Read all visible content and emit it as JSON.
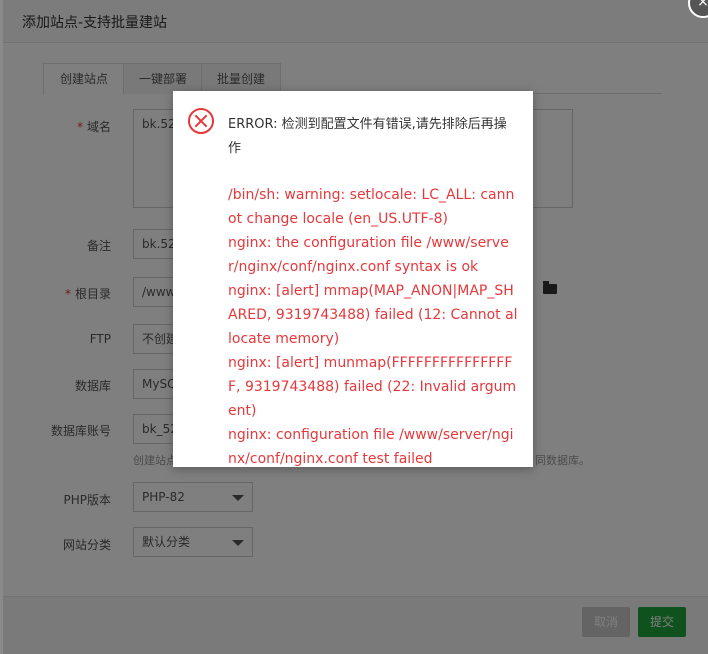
{
  "dialog": {
    "title": "添加站点-支持批量建站",
    "tabs": [
      "创建站点",
      "一键部署",
      "批量创建"
    ]
  },
  "form": {
    "domain_label": "域名",
    "domain_value": "bk.52",
    "remark_label": "备注",
    "remark_value": "bk.52",
    "root_label": "根目录",
    "root_value": "/www",
    "ftp_label": "FTP",
    "ftp_value": "不创建",
    "db_label": "数据库",
    "db_value": "MySQ",
    "db_account_label": "数据库账号",
    "db_account_value": "bk_52",
    "db_hint_left": "创建站点",
    "db_hint_right": "同数据库。",
    "php_label": "PHP版本",
    "php_value": "PHP-82",
    "category_label": "网站分类",
    "category_value": "默认分类"
  },
  "footer": {
    "cancel_label": "取消",
    "submit_label": "提交"
  },
  "error": {
    "title": "ERROR: 检测到配置文件有错误,请先排除后再操作",
    "lines": [
      "/bin/sh: warning: setlocale: LC_ALL: cannot change locale (en_US.UTF-8)",
      "nginx: the configuration file /www/server/nginx/conf/nginx.conf syntax is ok",
      "nginx: [alert] mmap(MAP_ANON|MAP_SHARED, 9319743488) failed (12: Cannot allocate memory)",
      "nginx: [alert] munmap(FFFFFFFFFFFFFFFF, 9319743488) failed (22: Invalid argument)",
      "nginx: configuration file /www/server/nginx/conf/nginx.conf test failed"
    ]
  },
  "colors": {
    "accent": "#20a53a",
    "error": "#e4393c"
  }
}
